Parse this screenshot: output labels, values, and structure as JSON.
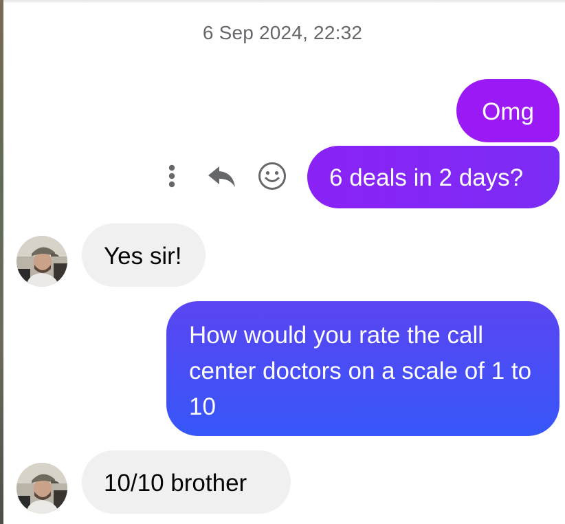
{
  "conversation": {
    "timestamp": "6 Sep 2024, 22:32",
    "messages": [
      {
        "sender": "me",
        "text": "Omg"
      },
      {
        "sender": "me",
        "text": "6 deals in 2 days?"
      },
      {
        "sender": "contact",
        "text": "Yes sir!"
      },
      {
        "sender": "me",
        "text": "How would you rate the call center doctors on a scale of 1 to 10"
      },
      {
        "sender": "contact",
        "text": "10/10 brother"
      }
    ]
  },
  "message_actions": {
    "icons": [
      "more-vertical-icon",
      "reply-icon",
      "smiley-icon"
    ]
  },
  "colors": {
    "outgoing_purple": "#9b19f5",
    "outgoing_violet": "#7b2cf4",
    "outgoing_blue": "#3656f8",
    "incoming_bg": "#f0f0f0",
    "timestamp_text": "#65676b",
    "action_icon": "#65676b"
  }
}
